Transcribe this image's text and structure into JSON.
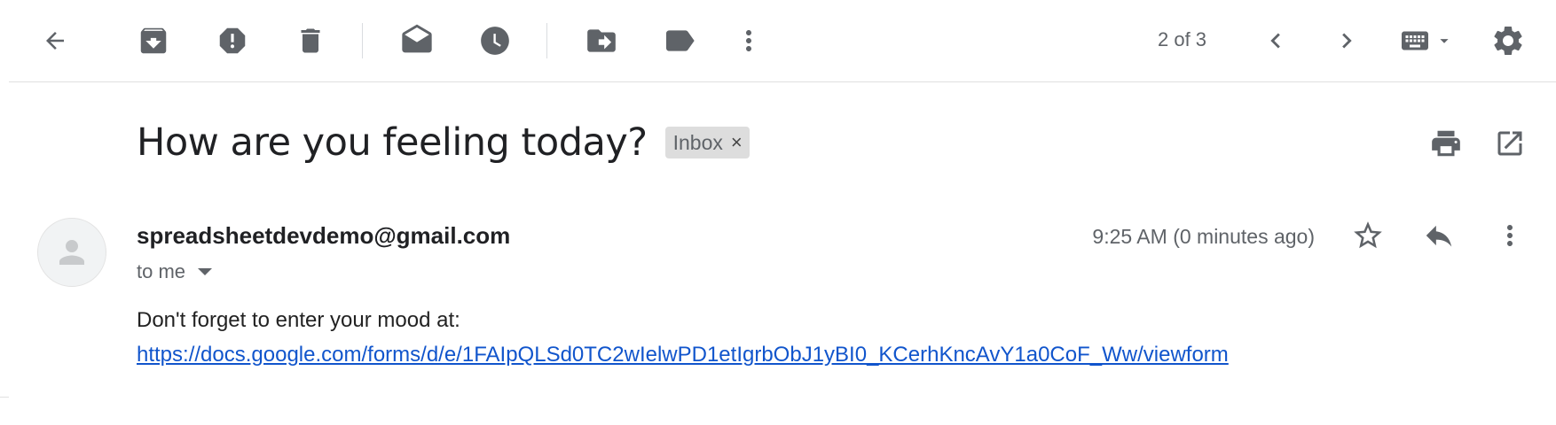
{
  "toolbar": {
    "back_icon": "arrow-back-icon",
    "actions": [
      {
        "icon": "archive-icon"
      },
      {
        "icon": "report-spam-icon"
      },
      {
        "icon": "delete-icon"
      },
      {
        "icon": "mark-unread-icon"
      },
      {
        "icon": "snooze-icon"
      },
      {
        "icon": "move-to-icon"
      },
      {
        "icon": "label-icon"
      },
      {
        "icon": "more-vert-icon"
      }
    ],
    "pager": "2 of 3",
    "settings_icon": "gear-icon",
    "keyboard_icon": "keyboard-icon"
  },
  "message": {
    "subject": "How are you feeling today?",
    "label": "Inbox",
    "label_remove": "×",
    "sender": "spreadsheetdevdemo@gmail.com",
    "recipient": "to me",
    "timestamp": "9:25 AM (0 minutes ago)",
    "body_text": "Don't forget to enter your mood at:",
    "link": "https://docs.google.com/forms/d/e/1FAIpQLSd0TC2wIelwPD1etIgrbObJ1yBI0_KCerhKncAvY1a0CoF_Ww/viewform"
  },
  "colors": {
    "icon": "#5f6368",
    "link": "#1155cc",
    "chip_bg": "#dddddd"
  }
}
